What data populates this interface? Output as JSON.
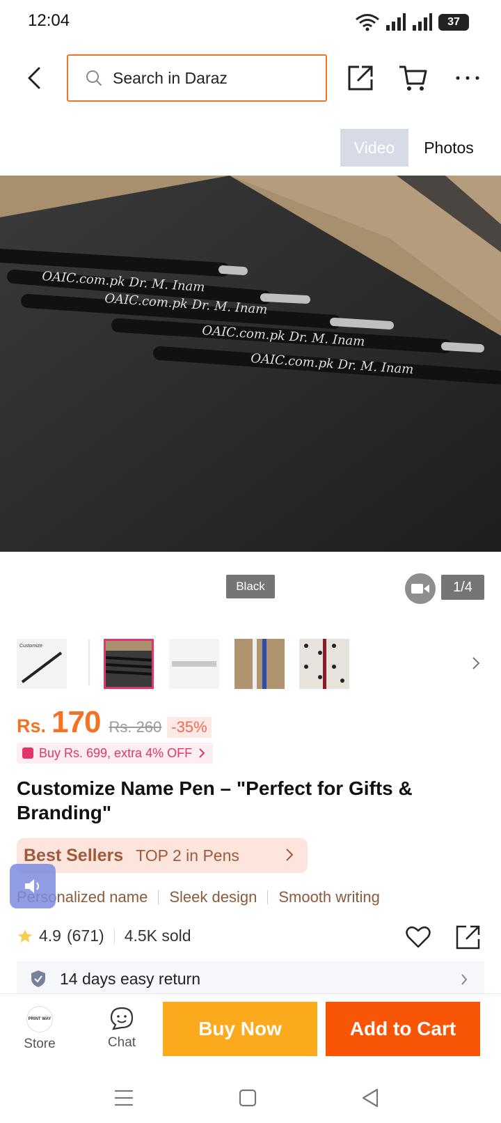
{
  "status": {
    "time": "12:04",
    "battery": "37"
  },
  "search": {
    "placeholder": "Search in Daraz"
  },
  "header_icons": {
    "back": "back-arrow-icon",
    "share": "share-icon",
    "cart": "cart-icon",
    "more": "more-icon"
  },
  "media_tabs": {
    "video": "Video",
    "photos": "Photos"
  },
  "gallery": {
    "variant_badge": "Black",
    "counter": "1/4"
  },
  "price": {
    "currency": "Rs.",
    "current": "170",
    "original": "Rs. 260",
    "discount": "-35%"
  },
  "promo": {
    "text": "Buy Rs. 699, extra 4% OFF"
  },
  "product": {
    "title": "Customize Name Pen – \"Perfect for Gifts & Branding\""
  },
  "best_sellers": {
    "label": "Best Sellers",
    "rank": "TOP 2 in Pens"
  },
  "highlights": [
    "Personalized name",
    "Sleek design",
    "Smooth writing"
  ],
  "rating": {
    "score": "4.9",
    "count": "(671)",
    "sold": "4.5K sold"
  },
  "return_policy": {
    "text": "14 days easy return"
  },
  "bottom_bar": {
    "store_label": "Store",
    "chat_label": "Chat",
    "buy_now": "Buy Now",
    "add_to_cart": "Add to Cart"
  },
  "colors": {
    "accent": "#f57224",
    "buy_now": "#fcaa1d",
    "add_to_cart": "#f85606",
    "promo": "#e4356b"
  }
}
